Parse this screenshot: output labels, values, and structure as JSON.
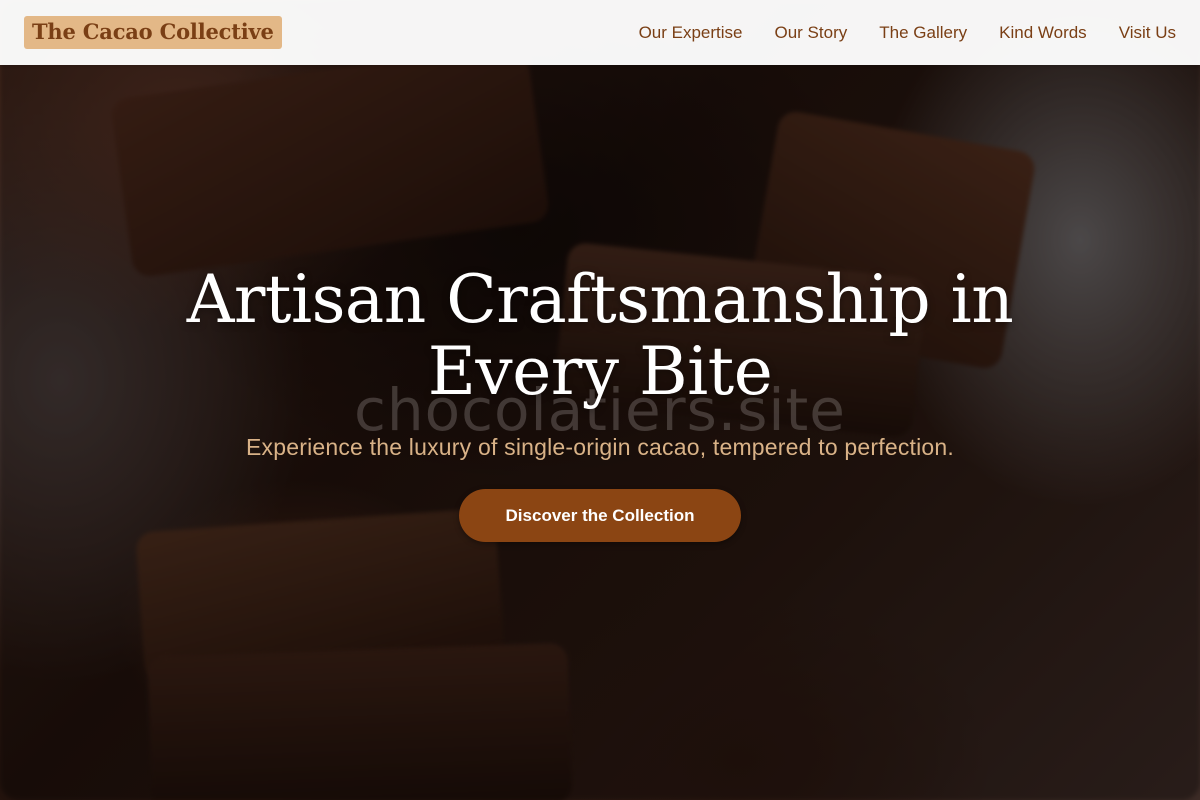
{
  "header": {
    "brand": "The Cacao Collective",
    "nav": [
      {
        "label": "Our Expertise"
      },
      {
        "label": "Our Story"
      },
      {
        "label": "The Gallery"
      },
      {
        "label": "Kind Words"
      },
      {
        "label": "Visit Us"
      }
    ]
  },
  "hero": {
    "title": "Artisan Craftsmanship in Every Bite",
    "subtitle": "Experience the luxury of single-origin cacao, tempered to perfection.",
    "cta_label": "Discover the Collection",
    "watermark": "chocolatiers.site"
  },
  "colors": {
    "brand_bg": "#e3b887",
    "brand_text": "#7a3f15",
    "cta_bg": "#8b4513",
    "subtitle": "#d9b287"
  }
}
